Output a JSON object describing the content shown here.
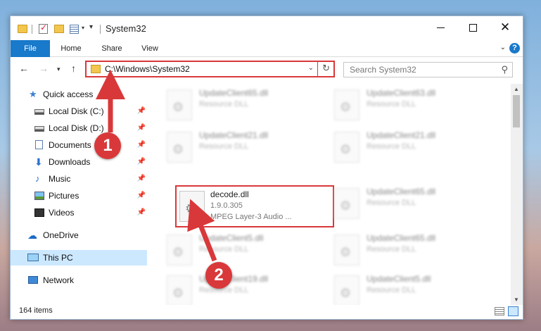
{
  "window": {
    "title": "System32",
    "minimize_icon": "minimize-icon",
    "maximize_icon": "maximize-icon",
    "close_glyph": "✕"
  },
  "ribbon": {
    "tabs": [
      "File",
      "Home",
      "Share",
      "View"
    ],
    "help_glyph": "?"
  },
  "address": {
    "path": "C:\\Windows\\System32",
    "search_placeholder": "Search System32"
  },
  "nav_pane": {
    "items": [
      {
        "label": "Quick access",
        "icon": "star-icon",
        "pinned": false
      },
      {
        "label": "Local Disk (C:)",
        "icon": "drive-icon",
        "pinned": true
      },
      {
        "label": "Local Disk (D:)",
        "icon": "drive-icon",
        "pinned": true
      },
      {
        "label": "Documents",
        "icon": "documents-icon",
        "pinned": true
      },
      {
        "label": "Downloads",
        "icon": "download-icon",
        "pinned": true
      },
      {
        "label": "Music",
        "icon": "music-icon",
        "pinned": true
      },
      {
        "label": "Pictures",
        "icon": "pictures-icon",
        "pinned": true
      },
      {
        "label": "Videos",
        "icon": "videos-icon",
        "pinned": true
      },
      {
        "label": "OneDrive",
        "icon": "cloud-icon",
        "pinned": false
      },
      {
        "label": "This PC",
        "icon": "pc-icon",
        "pinned": false,
        "selected": true
      },
      {
        "label": "Network",
        "icon": "network-icon",
        "pinned": false
      }
    ]
  },
  "files": [
    {
      "name": "UpdateClient65.dll",
      "line2": "Resource DLL",
      "line3": "",
      "blurred": true
    },
    {
      "name": "UpdateClient63.dll",
      "line2": "Resource DLL",
      "line3": "",
      "blurred": true
    },
    {
      "name": "UpdateClient21.dll",
      "line2": "Resource DLL",
      "line3": "",
      "blurred": true
    },
    {
      "name": "UpdateClient21.dll",
      "line2": "Resource DLL",
      "line3": "",
      "blurred": true
    },
    {
      "name": "decode.dll",
      "line2": "1.9.0.305",
      "line3": "MPEG Layer-3 Audio ...",
      "blurred": false,
      "highlighted": true
    },
    {
      "name": "UpdateClient65.dll",
      "line2": "Resource DLL",
      "line3": "",
      "blurred": true
    },
    {
      "name": "UpdateClient5.dll",
      "line2": "Resource DLL",
      "line3": "",
      "blurred": true
    },
    {
      "name": "UpdateClient65.dll",
      "line2": "Resource DLL",
      "line3": "",
      "blurred": true
    },
    {
      "name": "UpdateClient19.dll",
      "line2": "Resource DLL",
      "line3": "",
      "blurred": true
    },
    {
      "name": "UpdateClient5.dll",
      "line2": "Resource DLL",
      "line3": "",
      "blurred": true
    }
  ],
  "status": {
    "item_count": "164 items"
  },
  "callouts": [
    "1",
    "2"
  ],
  "colors": {
    "accent": "#1979ca",
    "highlight": "#d9383a",
    "selected_bg": "#cce8ff"
  }
}
